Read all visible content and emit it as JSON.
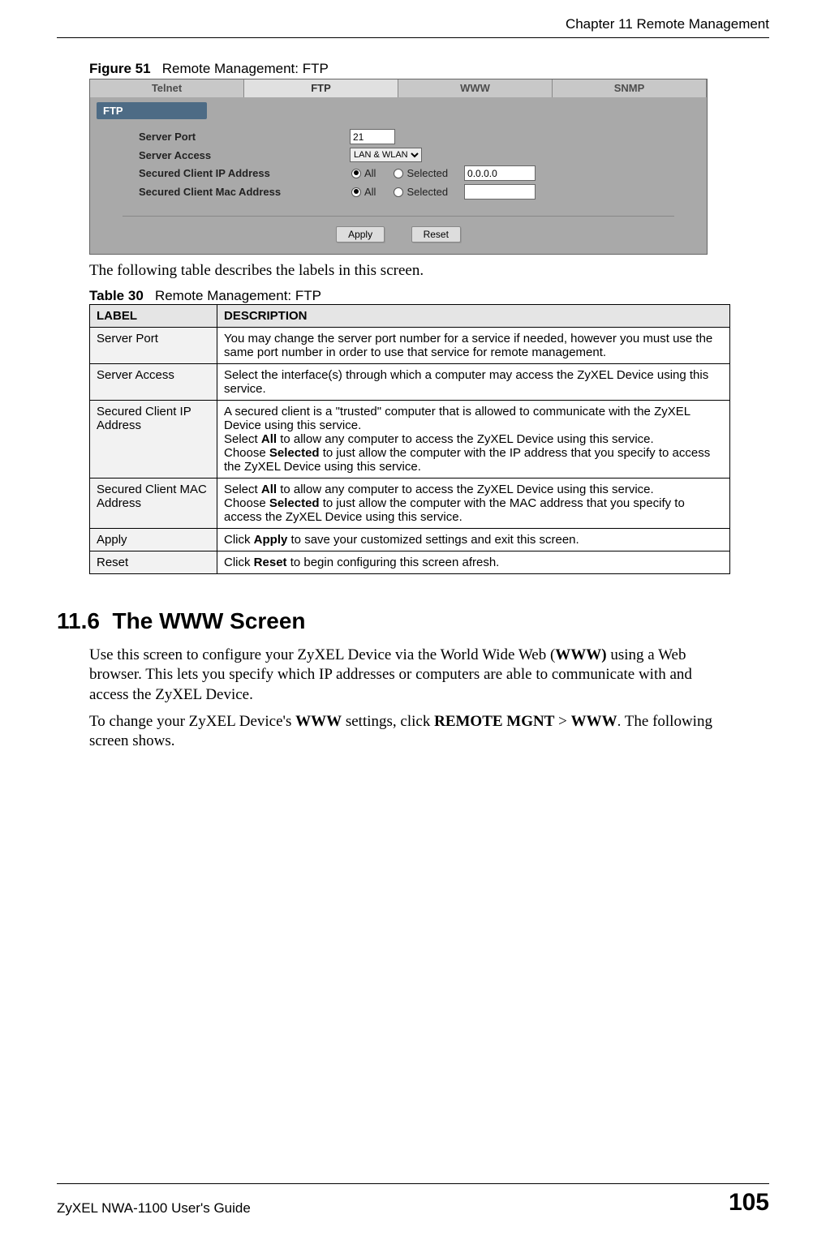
{
  "header": {
    "chapter": "Chapter 11 Remote Management"
  },
  "figure": {
    "label": "Figure 51",
    "title": "Remote Management: FTP",
    "tabs": [
      "Telnet",
      "FTP",
      "WWW",
      "SNMP"
    ],
    "active_tab": "FTP",
    "section_label": "FTP",
    "rows": {
      "server_port_label": "Server Port",
      "server_port_value": "21",
      "server_access_label": "Server Access",
      "server_access_value": "LAN & WLAN",
      "ip_label": "Secured Client IP Address",
      "ip_all": "All",
      "ip_selected": "Selected",
      "ip_value": "0.0.0.0",
      "mac_label": "Secured Client Mac Address",
      "mac_all": "All",
      "mac_selected": "Selected",
      "mac_value": ""
    },
    "buttons": {
      "apply": "Apply",
      "reset": "Reset"
    }
  },
  "intro_text": "The following table describes the labels in this screen.",
  "table": {
    "label": "Table 30",
    "title": "Remote Management: FTP",
    "col1": "LABEL",
    "col2": "DESCRIPTION",
    "rows": [
      {
        "label": "Server Port",
        "desc": "You may change the server port number for a service if needed, however you must use the same port number in order to use that service for remote management."
      },
      {
        "label": "Server Access",
        "desc": "Select the interface(s) through which a computer may access the ZyXEL Device using this service."
      },
      {
        "label": "Secured Client IP Address",
        "desc_p1": "A secured client is a \"trusted\" computer that is allowed to communicate with the ZyXEL Device using this service.",
        "desc_p2a": "Select ",
        "desc_p2b": "All",
        "desc_p2c": " to allow any computer to access the ZyXEL Device using this service.",
        "desc_p3a": "Choose ",
        "desc_p3b": "Selected",
        "desc_p3c": " to just allow the computer with the IP address that you specify to access the ZyXEL Device using this service."
      },
      {
        "label": "Secured Client MAC Address",
        "desc_p1a": "Select ",
        "desc_p1b": "All",
        "desc_p1c": " to allow any computer to access the ZyXEL Device using this service.",
        "desc_p2a": "Choose ",
        "desc_p2b": "Selected",
        "desc_p2c": " to just allow the computer with the MAC address that you specify to access the ZyXEL Device using this service."
      },
      {
        "label": "Apply",
        "desc_a": "Click ",
        "desc_b": "Apply",
        "desc_c": " to save your customized settings and exit this screen."
      },
      {
        "label": "Reset",
        "desc_a": "Click ",
        "desc_b": "Reset",
        "desc_c": " to begin configuring this screen afresh."
      }
    ]
  },
  "section": {
    "number": "11.6",
    "title": "The WWW Screen",
    "p1_a": "Use this screen to configure your ZyXEL Device via the World Wide Web (",
    "p1_b": "WWW)",
    "p1_c": " using a Web browser. This lets you specify which IP addresses or computers are able to communicate with and access the ZyXEL Device.",
    "p2_a": "To change your ZyXEL Device's ",
    "p2_b": "WWW",
    "p2_c": " settings, click ",
    "p2_d": "REMOTE MGNT",
    "p2_e": " > ",
    "p2_f": "WWW",
    "p2_g": ". The following screen shows."
  },
  "footer": {
    "left": "ZyXEL NWA-1100 User's Guide",
    "right": "105"
  }
}
